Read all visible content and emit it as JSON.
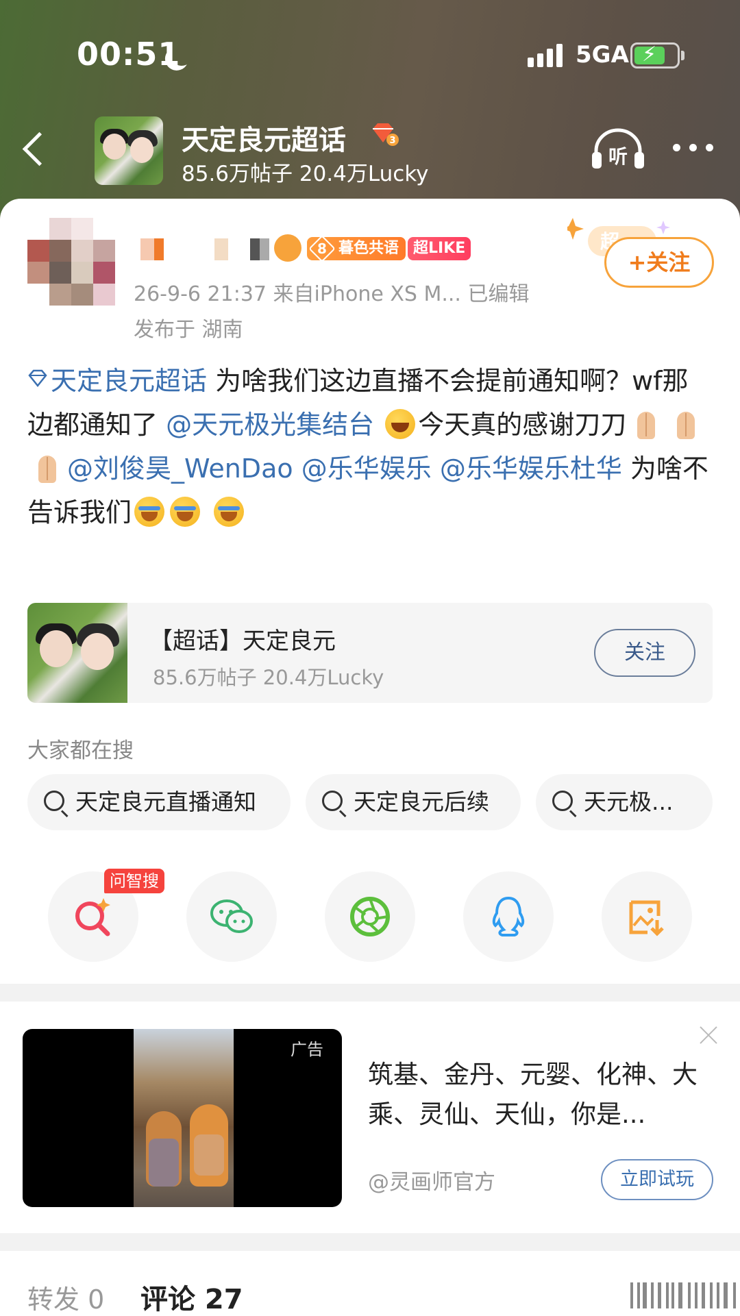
{
  "status_bar": {
    "time": "00:51",
    "network": "5GA"
  },
  "topic_header": {
    "title": "天定良元超话",
    "level_badge": "3",
    "subtitle": "85.6万帖子 20.4万Lucky",
    "listen_label": "听"
  },
  "post": {
    "badges": {
      "level": "8",
      "level_text": "暮色共语",
      "like_text": "超LIKE"
    },
    "meta": "26-9-6 21:37  来自iPhone XS M...  已编辑",
    "location": "发布于 湖南",
    "follow_label": "+关注",
    "follow_deco": "超",
    "body": {
      "topic_link": "天定良元超话",
      "text1": " 为啥我们这边直播不会提前通知啊？wf那边都通知了",
      "mention1": "@天元极光集结台",
      "text2": "今天真的感谢刀刀",
      "mention2": "@刘俊昊_WenDao",
      "mention3": "@乐华娱乐",
      "mention4": "@乐华娱乐杜华",
      "text3": " 为啥不告诉我们"
    }
  },
  "topic_card": {
    "title": "【超话】天定良元",
    "subtitle": "85.6万帖子 20.4万Lucky",
    "follow_label": "关注"
  },
  "search": {
    "heading": "大家都在搜",
    "chips": [
      "天定良元直播通知",
      "天定良元后续",
      "天元极..."
    ]
  },
  "share": {
    "wzs_tag": "问智搜",
    "icons": [
      "ai-search-icon",
      "wechat-icon",
      "moments-icon",
      "qq-icon",
      "save-image-icon"
    ]
  },
  "ad": {
    "tag": "广告",
    "text": "筑基、金丹、元婴、化神、大乘、灵仙、天仙，你是...",
    "source": "@灵画师官方",
    "cta": "立即试玩"
  },
  "tabs": {
    "repost": "转发 0",
    "comment": "评论 27"
  },
  "colors": {
    "accent_orange": "#f7a33b",
    "link_blue": "#3a6fb0",
    "badge_red": "#ff3d5f"
  }
}
